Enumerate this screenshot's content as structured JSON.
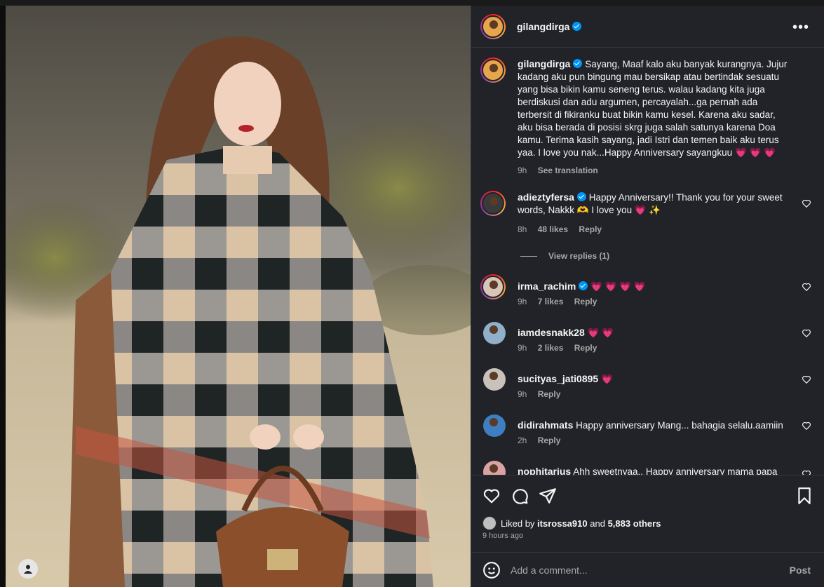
{
  "post": {
    "author": "gilangdirga",
    "caption": "Sayang, Maaf kalo aku banyak kurangnya. Jujur kadang aku pun bingung mau bersikap atau bertindak sesuatu yang bisa bikin kamu seneng terus. walau kadang kita juga berdiskusi dan adu argumen, percayalah...ga pernah ada terbersit di fikiranku buat bikin kamu kesel. Karena aku sadar, aku bisa berada di posisi skrg juga salah satunya karena Doa kamu. Terima kasih sayang, jadi Istri dan temen baik aku terus yaa. I love you nak...Happy Anniversary sayangkuu",
    "caption_hearts": "💗 💗 💗",
    "caption_time": "9h",
    "see_translation": "See translation"
  },
  "comments": [
    {
      "user": "adieztyfersa",
      "verified": true,
      "text": "Happy Anniversary!! Thank you for your sweet words, Nakkk 🫶 I love you 💗 ✨",
      "time": "8h",
      "likes": "48 likes",
      "reply": "Reply"
    },
    {
      "user": "irma_rachim",
      "verified": true,
      "text": "💗 💗 💗 💗",
      "time": "9h",
      "likes": "7 likes",
      "reply": "Reply"
    },
    {
      "user": "iamdesnakk28",
      "verified": false,
      "text": "💗 💗",
      "time": "9h",
      "likes": "2 likes",
      "reply": "Reply"
    },
    {
      "user": "sucityas_jati0895",
      "verified": false,
      "text": "💗",
      "time": "9h",
      "likes": "",
      "reply": "Reply"
    },
    {
      "user": "didirahmats",
      "verified": false,
      "text": "Happy anniversary Mang... bahagia selalu.aamiin",
      "time": "2h",
      "likes": "",
      "reply": "Reply"
    },
    {
      "user": "nophitarius",
      "verified": false,
      "text": "Ahh sweetnyaa.. Happy anniversary mama papa",
      "time": "",
      "likes": "",
      "reply": ""
    }
  ],
  "view_replies": "View replies (1)",
  "liked_by": {
    "prefix": "Liked by",
    "user": "itsrossa910",
    "and": "and",
    "others": "5,883 others"
  },
  "time_ago": "9 hours ago",
  "add_comment": {
    "placeholder": "Add a comment...",
    "post_label": "Post"
  },
  "icons": {
    "more": "more-options-icon",
    "like": "heart-icon",
    "comment": "comment-icon",
    "share": "share-icon",
    "save": "bookmark-icon",
    "emoji": "emoji-icon"
  },
  "colors": {
    "panel_bg": "#212328",
    "accent_blue": "#0095f6",
    "heart_red": "#ff3040"
  }
}
